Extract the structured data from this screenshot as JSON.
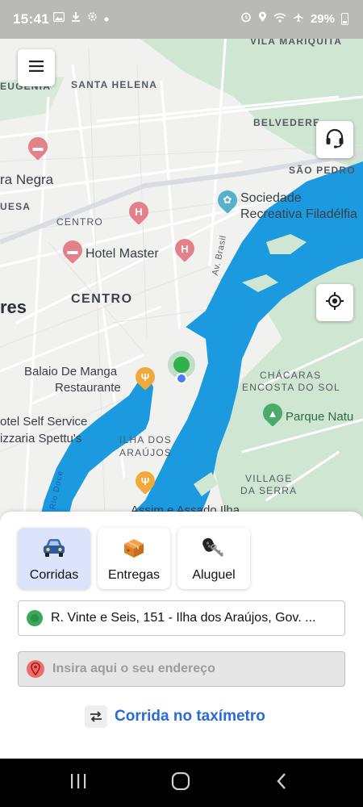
{
  "status_bar": {
    "time": "15:41",
    "battery": "29%",
    "left_icons": [
      "image-icon",
      "download-icon",
      "settings-icon",
      "dot-icon"
    ],
    "right_icons": [
      "alarm-icon",
      "location-icon",
      "wifi-icon",
      "airplane-icon",
      "battery-icon"
    ]
  },
  "map": {
    "labels": {
      "vila_mariquita": "VILA MARIQUITA",
      "eugenia": "EUGÊNIA",
      "santa_helena": "SANTA HELENA",
      "belvedere": "BELVEDERE",
      "sao_pedro": "SÃO PEDRO",
      "ra_negra": "ra Negra",
      "uesa": "UESA",
      "centro_small": "CENTRO",
      "sociedade": "Sociedade",
      "recreativa": "Recreativa Filadélfia",
      "hotel_master": "Hotel Master",
      "av_brasil": "Av. Brasil",
      "centro_big": "CENTRO",
      "res": "res",
      "balaio1": "Balaio De Manga",
      "balaio2": "Restaurante",
      "chacaras1": "CHÁCARAS",
      "chacaras2": "ENCOSTA DO SOL",
      "parque": "Parque Natu",
      "hotel_self": "otel Self Service",
      "pizzaria": "izzaria Spettu's",
      "ilha1": "ILHA DOS",
      "ilha2": "ARAÚJOS",
      "village1": "VILLAGE",
      "village2": "DA SERRA",
      "assim": "Assim e Assado Ilha",
      "river": "Rio Doce"
    },
    "colors": {
      "land": "#f2f2f0",
      "green": "#cfe8d2",
      "water": "#1b9ae0",
      "road": "#ffffff"
    }
  },
  "buttons": {
    "menu_icon": "menu-icon",
    "support_icon": "headset-icon",
    "recenter_icon": "gps-icon"
  },
  "sheet": {
    "tabs": [
      {
        "label": "Corridas",
        "icon": "car-icon",
        "active": true
      },
      {
        "label": "Entregas",
        "icon": "package-icon",
        "active": false
      },
      {
        "label": "Aluguel",
        "icon": "car-keys-icon",
        "active": false
      }
    ],
    "origin": "R. Vinte e Seis, 151 - Ilha dos Araújos, Gov. ...",
    "destination_placeholder": "Insira aqui o seu endereço",
    "taximeter_label": "Corrida no taxímetro",
    "accent": "#2a6ad8"
  }
}
